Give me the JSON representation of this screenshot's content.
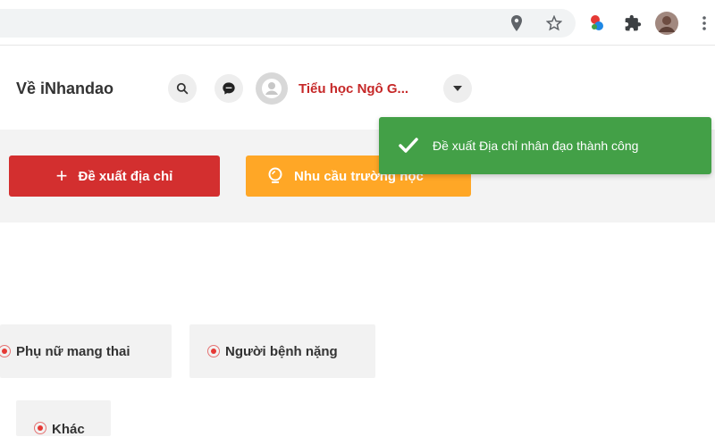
{
  "browser": {
    "icons": [
      "location-icon",
      "star-icon",
      "extension-colorful-icon",
      "puzzle-icon",
      "profile-avatar",
      "more-vert-icon"
    ]
  },
  "header": {
    "brand_link": "Về iNhandao",
    "user_name": "Tiểu học Ngô G..."
  },
  "actions": {
    "suggest_label": "Đề xuất địa chỉ",
    "needs_label": "Nhu cầu trường học"
  },
  "toast": {
    "message": "Đề xuất Địa chỉ nhân đạo thành công",
    "color": "#43a047"
  },
  "categories": {
    "pregnant": "Phụ nữ mang thai",
    "seriously_ill": "Người bệnh nặng",
    "other": "Khác"
  },
  "colors": {
    "brand_red": "#d32f2f",
    "accent_orange": "#ffa726",
    "success_green": "#43a047"
  }
}
